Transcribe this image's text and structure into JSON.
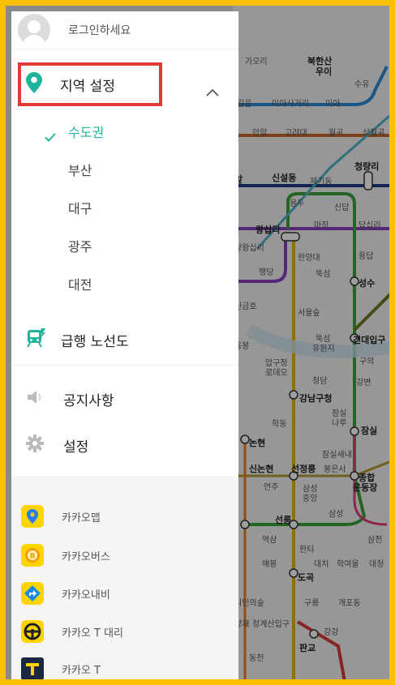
{
  "profile": {
    "login_text": "로그인하세요"
  },
  "region": {
    "title": "지역 설정",
    "items": [
      {
        "label": "수도권",
        "selected": true
      },
      {
        "label": "부산",
        "selected": false
      },
      {
        "label": "대구",
        "selected": false
      },
      {
        "label": "광주",
        "selected": false
      },
      {
        "label": "대전",
        "selected": false
      }
    ]
  },
  "express": {
    "label": "급행 노선도"
  },
  "menu": {
    "notice": "공지사항",
    "settings": "설정"
  },
  "apps": [
    {
      "label": "카카오맵",
      "icon": "kakao-map-icon"
    },
    {
      "label": "카카오버스",
      "icon": "kakao-bus-icon"
    },
    {
      "label": "카카오내비",
      "icon": "kakao-navi-icon"
    },
    {
      "label": "카카오 T 대리",
      "icon": "kakao-t-driver-icon"
    },
    {
      "label": "카카오 T",
      "icon": "kakao-t-icon"
    }
  ],
  "map": {
    "stations": [
      "가오리",
      "북한산",
      "우이",
      "수유",
      "길음",
      "미아사거리",
      "미아",
      "안암",
      "고려대",
      "월곡",
      "상월곡",
      "신설동",
      "제기동",
      "청량리",
      "앞",
      "용두",
      "신답",
      "답십리",
      "왕십리",
      "마장",
      "상왕십리",
      "한양대",
      "용답",
      "행당",
      "뚝섬",
      "성수",
      "신금호",
      "서울숲",
      "뚝섬",
      "유원지",
      "건대입구",
      "옹봉",
      "압구정",
      "로데오",
      "구의",
      "청담",
      "강변",
      "강남구청",
      "잠실",
      "나루",
      "학동",
      "잠실",
      "논현",
      "신논현",
      "선정릉",
      "봉은사",
      "잠실새내",
      "종합",
      "운동장",
      "언주",
      "삼성",
      "중앙",
      "선릉",
      "삼성",
      "삼전",
      "역삼",
      "한티",
      "매봉",
      "도곡",
      "대치",
      "학여울",
      "대청",
      "구룡",
      "개포동",
      "시민의숲",
      "양재",
      "청계산입구",
      "판교",
      "동천",
      "강강"
    ]
  },
  "colors": {
    "accent": "#1fb59a",
    "highlight": "#e53935",
    "frame": "#f8c000"
  }
}
